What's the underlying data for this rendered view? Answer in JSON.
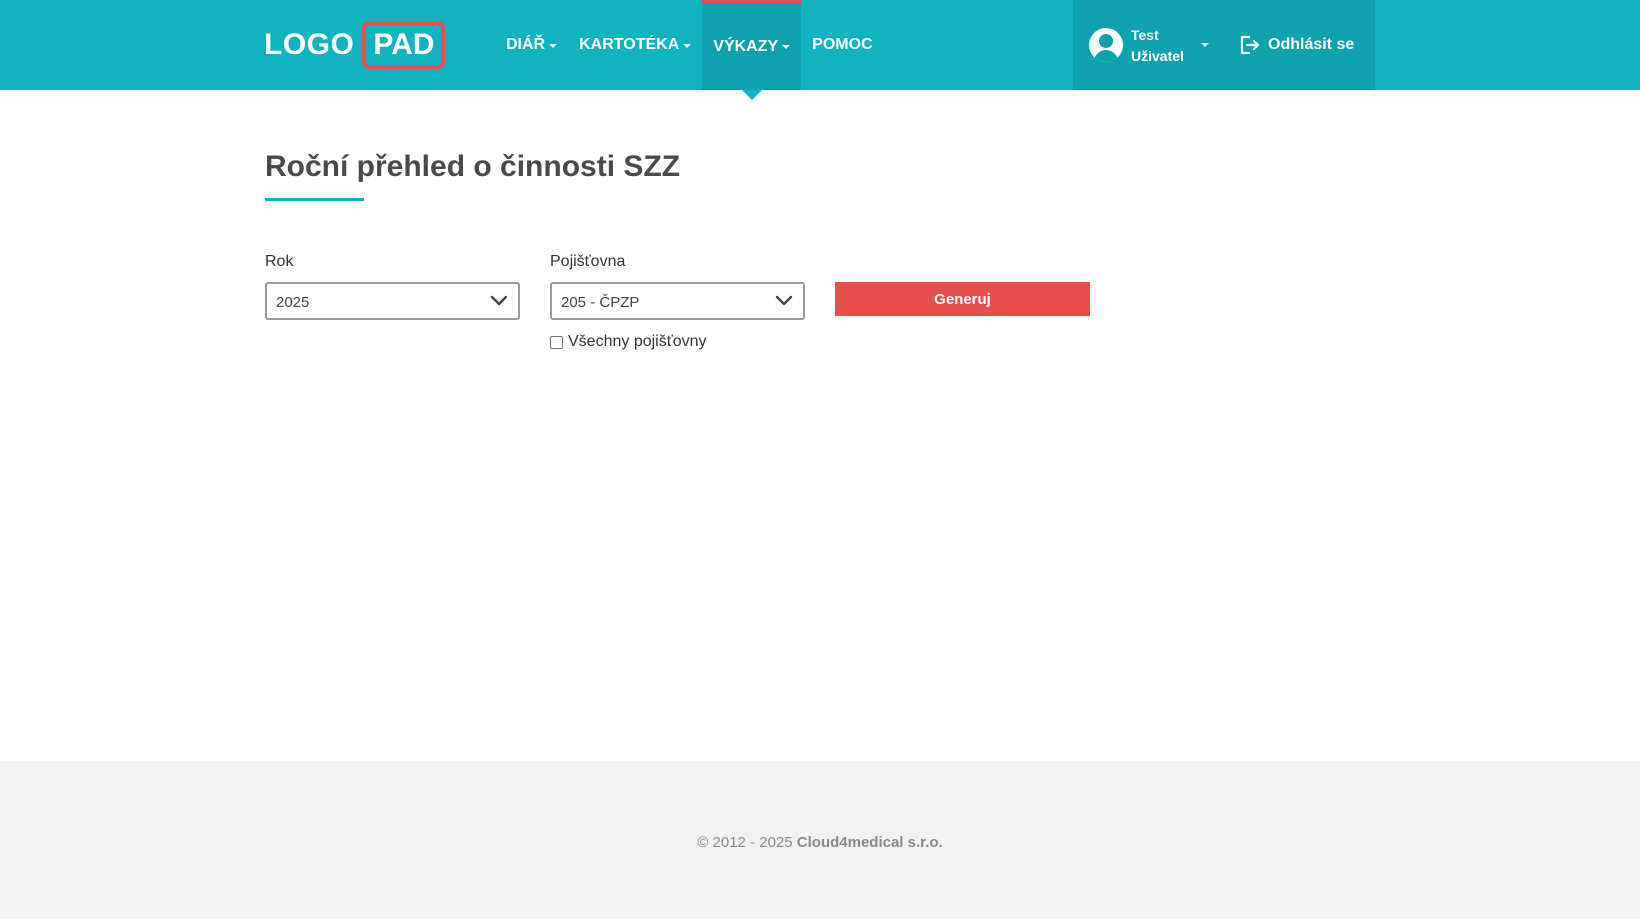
{
  "header": {
    "logo_part1": "LOGO",
    "logo_part2": "PAD",
    "nav": [
      {
        "label": "DIÁŘ",
        "has_dropdown": true,
        "active": false
      },
      {
        "label": "KARTOTÉKA",
        "has_dropdown": true,
        "active": false
      },
      {
        "label": "VÝKAZY",
        "has_dropdown": true,
        "active": true
      },
      {
        "label": "POMOC",
        "has_dropdown": false,
        "active": false
      }
    ],
    "user": {
      "first_name": "Test",
      "last_name": "Uživatel",
      "avatar_icon": "user-avatar-icon"
    },
    "logout_label": "Odhlásit se",
    "logout_icon": "logout-icon"
  },
  "main": {
    "title": "Roční přehled o činnosti SZZ",
    "form": {
      "year_label": "Rok",
      "year_value": "2025",
      "insurer_label": "Pojišťovna",
      "insurer_value": "205 - ČPZP",
      "all_insurers_label": "Všechny pojišťovny",
      "all_insurers_checked": false,
      "generate_label": "Generuj"
    }
  },
  "footer": {
    "copyright": "© 2012 - 2025",
    "company": "Cloud4medical s.r.o."
  },
  "colors": {
    "brand": "#12b3c0",
    "brand_dark": "#0fa1ad",
    "accent": "#e84e4e",
    "footer_bg": "#f2f2f2"
  }
}
